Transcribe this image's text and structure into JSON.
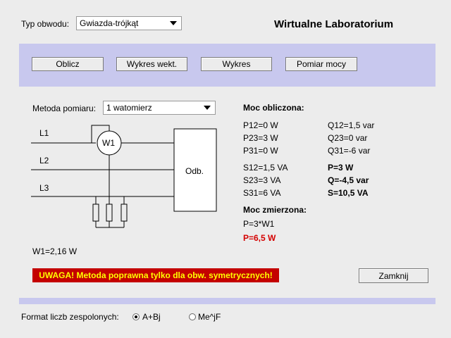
{
  "top": {
    "circuit_label": "Typ obwodu:",
    "circuit_value": "Gwiazda-trójkąt",
    "app_title": "Wirtualne Laboratorium"
  },
  "toolbar": {
    "calc": "Oblicz",
    "vector": "Wykres wekt.",
    "chart": "Wykres",
    "power": "Pomiar mocy"
  },
  "measure": {
    "label": "Metoda pomiaru:",
    "value": "1 watomierz"
  },
  "diagram": {
    "l1": "L1",
    "l2": "L2",
    "l3": "L3",
    "w1": "W1",
    "load": "Odb."
  },
  "w1_reading": "W1=2,16 W",
  "calculated": {
    "header": "Moc obliczona:",
    "p12": "P12=0 W",
    "p23": "P23=3 W",
    "p31": "P31=0 W",
    "q12": "Q12=1,5 var",
    "q23": "Q23=0 var",
    "q31": "Q31=-6 var",
    "s12": "S12=1,5 VA",
    "s23": "S23=3 VA",
    "s31": "S31=6 VA",
    "p": "P=3 W",
    "q": "Q=-4,5 var",
    "s": "S=10,5 VA"
  },
  "measured": {
    "header": "Moc zmierzona:",
    "formula": "P=3*W1",
    "result": "P=6,5 W"
  },
  "warning": "UWAGA! Metoda poprawna tylko dla obw. symetrycznych!",
  "close": "Zamknij",
  "format": {
    "label": "Format liczb zespolonych:",
    "opt1": "A+Bj",
    "opt2": "Me^jF"
  },
  "colors": {
    "panel": "#c8c8ee",
    "warning_bg": "#c40000",
    "measured_result": "#d40000"
  }
}
